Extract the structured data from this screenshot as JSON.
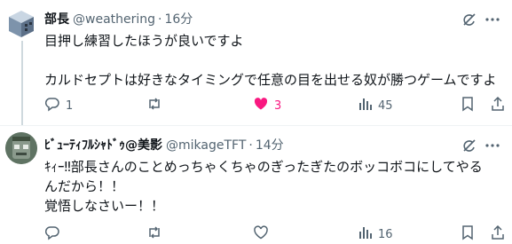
{
  "tweets": [
    {
      "name": "部長",
      "handle": "@weathering",
      "separator": "·",
      "time": "16分",
      "lines": [
        "目押し練習したほうが良いですよ",
        "",
        "カルドセプトは好きなタイミングで任意の目を出せる奴が勝つゲームですよ"
      ],
      "reply_count": "1",
      "retweet_count": "",
      "like_count": "3",
      "view_count": "45",
      "liked": true
    },
    {
      "name": "ﾋﾞｭｰﾃｨﾌﾙｼｬﾄﾞｩ@美影",
      "handle": "@mikageTFT",
      "separator": "·",
      "time": "14分",
      "lines": [
        "ｷｨｰ‼部長さんのことめっちゃくちゃのぎったぎたのボッコボコにしてやる",
        "んだから！！",
        "覚悟しなさいー！！"
      ],
      "reply_count": "",
      "retweet_count": "",
      "like_count": "",
      "view_count": "16",
      "liked": false
    }
  ],
  "colors": {
    "text": "#0f1419",
    "muted": "#536471",
    "like": "#f91880",
    "divider": "#eff3f4"
  },
  "icons": [
    "grok-icon",
    "more-icon",
    "reply-icon",
    "retweet-icon",
    "like-icon",
    "views-icon",
    "bookmark-icon",
    "share-icon"
  ]
}
